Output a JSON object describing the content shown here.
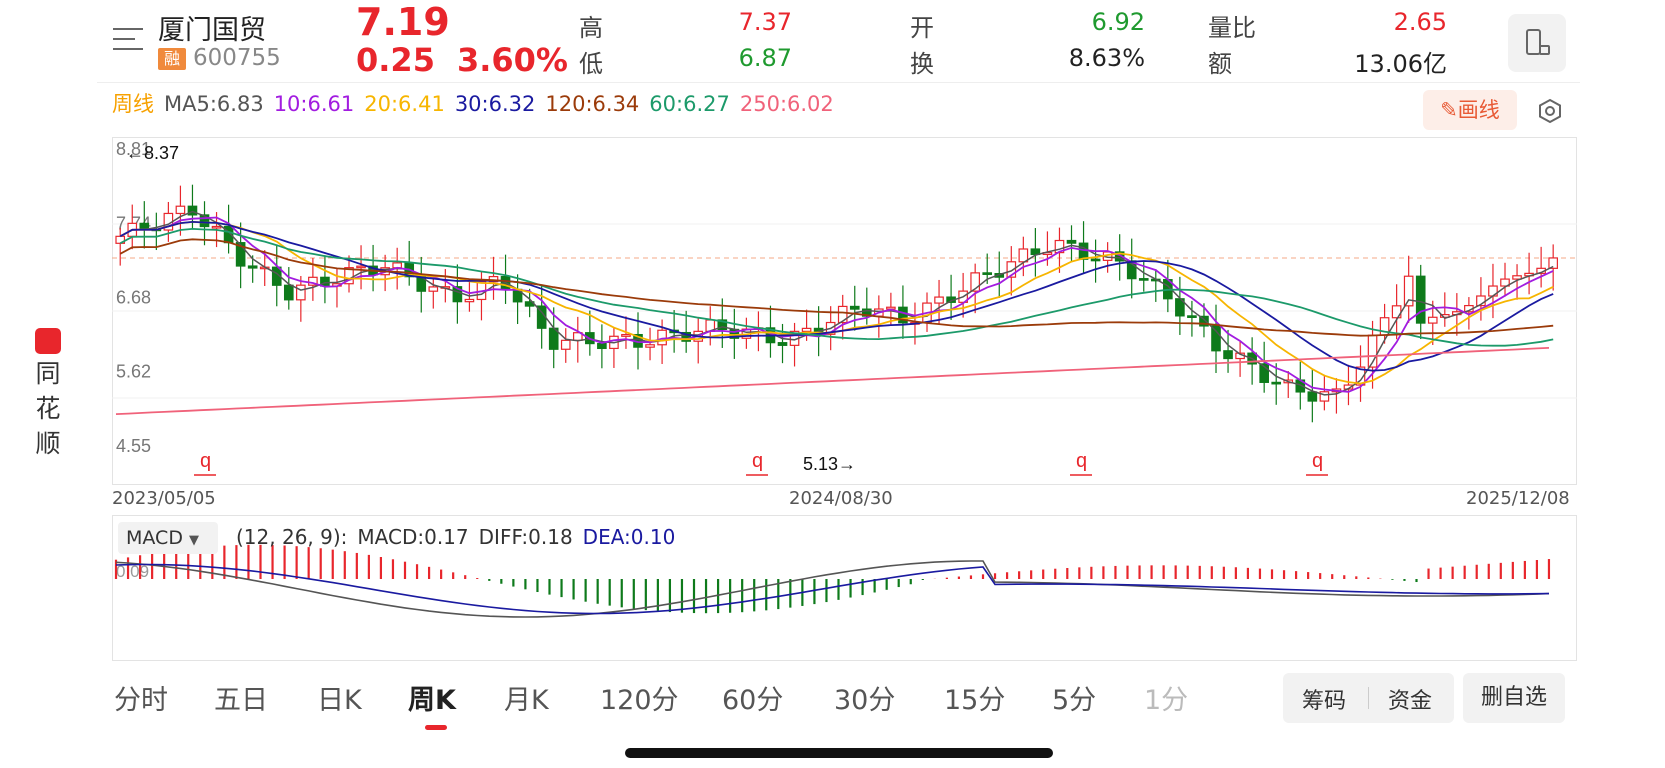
{
  "stock": {
    "name": "厦门国贸",
    "badge": "融",
    "code": "600755",
    "price": "7.19",
    "change": "0.25",
    "change_pct": "3.60%"
  },
  "quote": {
    "high_label": "高",
    "high": "7.37",
    "low_label": "低",
    "low": "6.87",
    "open_label": "开",
    "open": "6.92",
    "turnover_label": "换",
    "turnover": "8.63%",
    "volume_ratio_label": "量比",
    "volume_ratio": "2.65",
    "amount_label": "额",
    "amount": "13.06亿"
  },
  "ma_legend": {
    "period": "周线",
    "ma5": "MA5:6.83",
    "ma10": "10:6.61",
    "ma20": "20:6.41",
    "ma30": "30:6.32",
    "ma120": "120:6.34",
    "ma60": "60:6.27",
    "ma250": "250:6.02"
  },
  "colors": {
    "up": "#e8262c",
    "down": "#0e7a1b",
    "ma5": "#555555",
    "ma10": "#a21ce0",
    "ma20": "#f7b500",
    "ma30": "#1a1aa0",
    "ma120": "#9b3b0a",
    "ma60": "#1c9a6a",
    "ma250": "#f0627a"
  },
  "draw_button": "画线",
  "chart": {
    "y_labels": [
      "8.81",
      "7.74",
      "6.68",
      "5.62",
      "4.55"
    ],
    "max_label": "8.37",
    "min_label": "5.13",
    "dates": [
      "2023/05/05",
      "2024/08/30",
      "2025/12/08"
    ],
    "q_marker": "q"
  },
  "macd": {
    "select_label": "MACD",
    "params": "(12, 26, 9):",
    "macd": "MACD:0.17",
    "diff": "DIFF:0.18",
    "dea": "DEA:0.10",
    "y_label": "0.09"
  },
  "tabs": [
    "分时",
    "五日",
    "日K",
    "周K",
    "月K",
    "120分",
    "60分",
    "30分",
    "15分",
    "5分",
    "1分"
  ],
  "buttons": {
    "chips": "筹码",
    "funds": "资金",
    "delete": "删自选"
  },
  "side_logo": [
    "同",
    "花",
    "顺"
  ],
  "chart_data": {
    "type": "candlestick",
    "y_range": [
      4.55,
      8.81
    ],
    "key_points": [
      {
        "x": "2023/05/05",
        "y": 7.4
      },
      {
        "x": "high",
        "y": 8.37
      },
      {
        "x": "2024/08/30",
        "y": 5.13
      },
      {
        "x": "2025/12/08",
        "y": 7.19
      }
    ]
  }
}
